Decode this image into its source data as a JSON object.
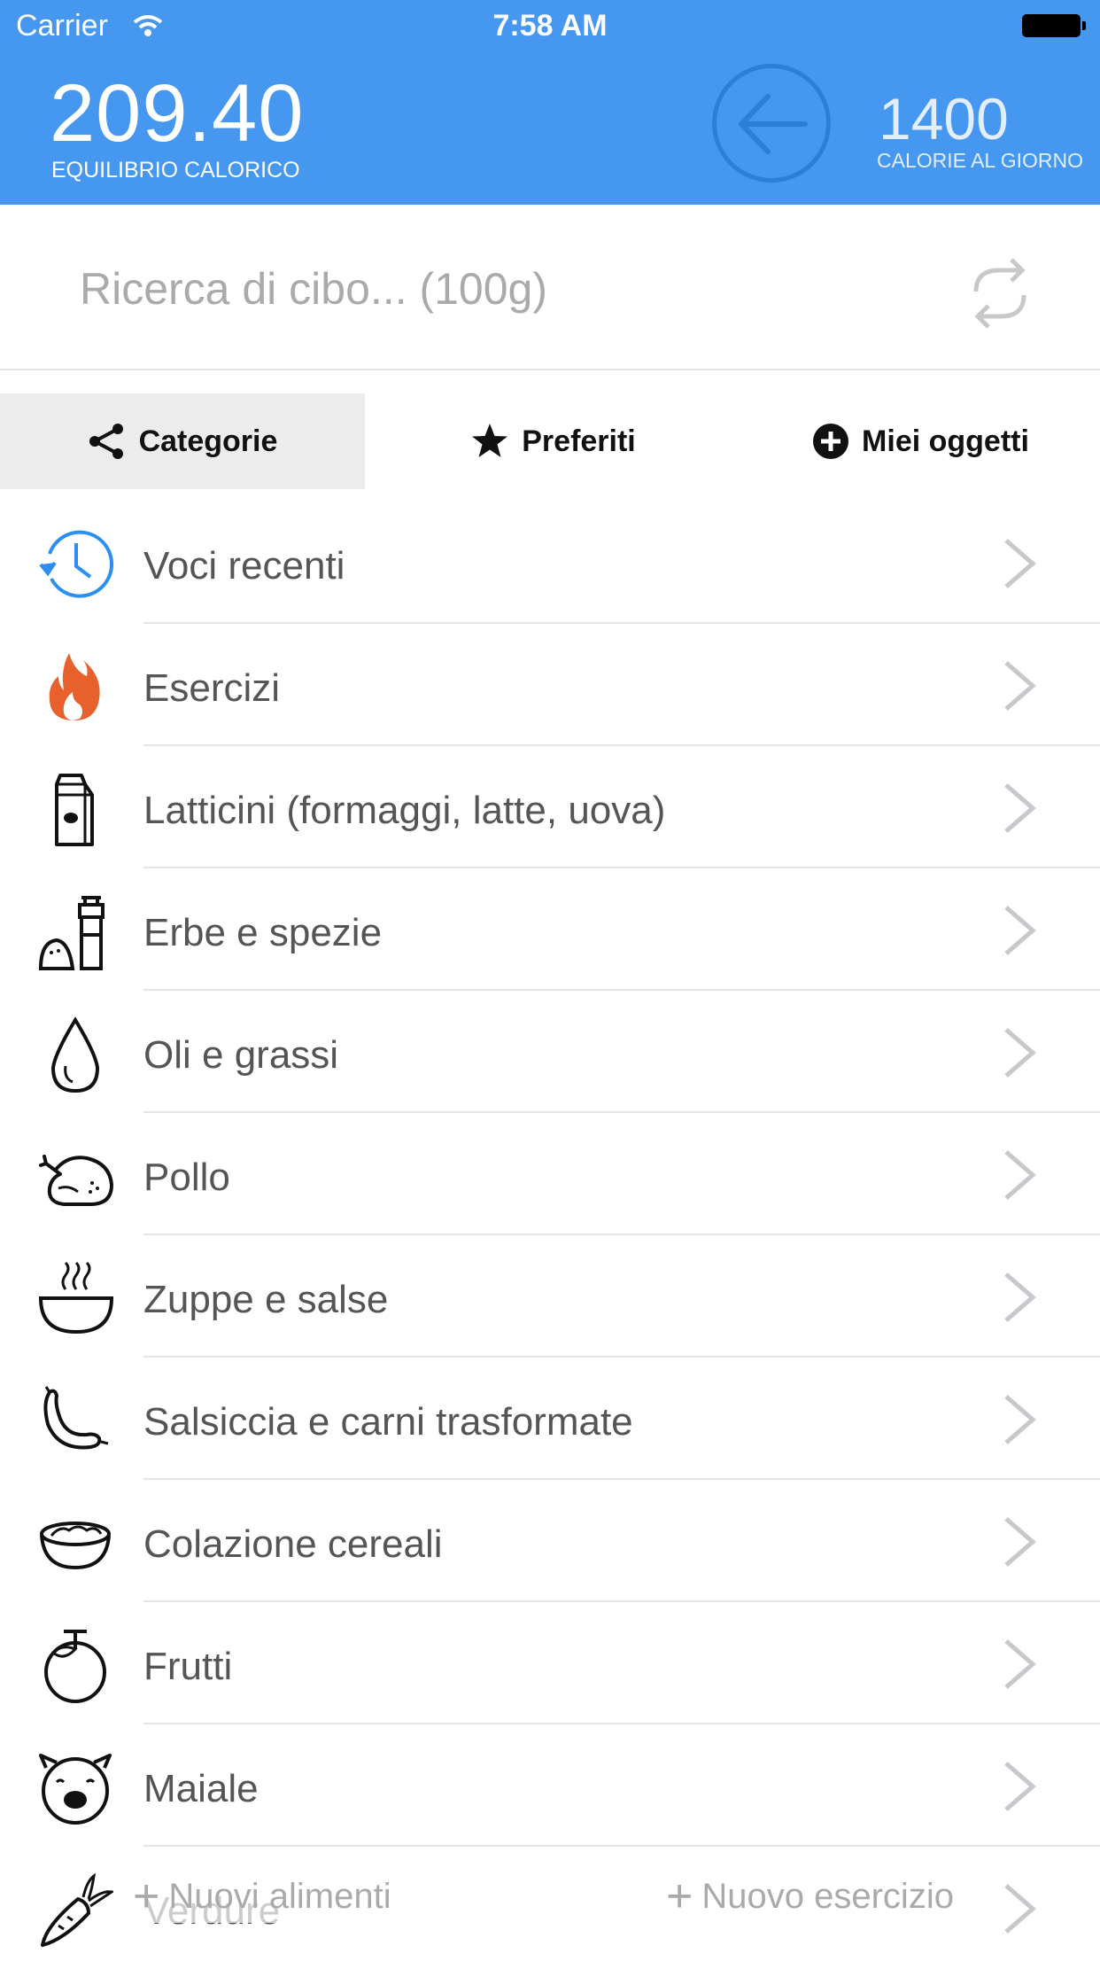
{
  "status_bar": {
    "carrier": "Carrier",
    "time": "7:58 AM"
  },
  "header": {
    "balance_value": "209.40",
    "balance_label": "EQUILIBRIO CALORICO",
    "goal_value": "1400",
    "goal_label": "CALORIE AL GIORNO"
  },
  "search": {
    "placeholder": "Ricerca di cibo... (100g)"
  },
  "tabs": [
    {
      "label": "Categorie",
      "icon": "share-icon",
      "active": true
    },
    {
      "label": "Preferiti",
      "icon": "star-icon",
      "active": false
    },
    {
      "label": "Miei oggetti",
      "icon": "plus-circle-icon",
      "active": false
    }
  ],
  "categories": [
    {
      "label": "Voci recenti",
      "icon": "history-clock-icon"
    },
    {
      "label": "Esercizi",
      "icon": "flame-icon"
    },
    {
      "label": "Latticini (formaggi, latte, uova)",
      "icon": "milk-carton-icon"
    },
    {
      "label": "Erbe e spezie",
      "icon": "spice-grinder-icon"
    },
    {
      "label": "Oli e grassi",
      "icon": "oil-drop-icon"
    },
    {
      "label": "Pollo",
      "icon": "chicken-icon"
    },
    {
      "label": "Zuppe e salse",
      "icon": "soup-bowl-icon"
    },
    {
      "label": "Salsiccia e carni trasformate",
      "icon": "sausage-icon"
    },
    {
      "label": "Colazione cereali",
      "icon": "cereal-bowl-icon"
    },
    {
      "label": "Frutti",
      "icon": "fruit-icon"
    },
    {
      "label": "Maiale",
      "icon": "pig-icon"
    },
    {
      "label": "Verdure",
      "icon": "carrot-icon"
    }
  ],
  "bottom_actions": {
    "new_food": "Nuovi alimenti",
    "new_exercise": "Nuovo esercizio"
  },
  "colors": {
    "header": "#4597ef",
    "accent_icon": "#2b8ef0",
    "flame": "#e8612c"
  }
}
